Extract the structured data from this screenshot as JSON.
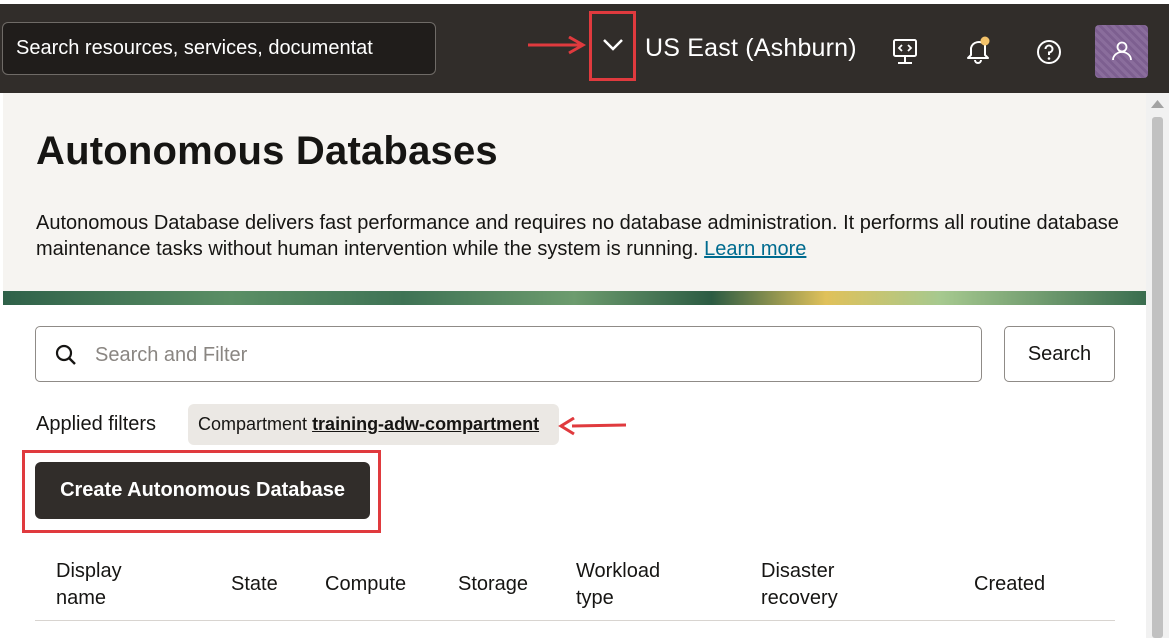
{
  "header": {
    "search_text": "Search resources, services, documentat",
    "region": "US East (Ashburn)",
    "icons": [
      "region-dropdown-chevron-icon",
      "cloud-shell-icon",
      "notifications-bell-icon",
      "help-icon",
      "profile-avatar-icon"
    ]
  },
  "hero": {
    "title": "Autonomous Databases",
    "description": "Autonomous Database delivers fast performance and requires no database administration. It performs all routine database maintenance tasks without human intervention while the system is running.",
    "learn_more": "Learn more"
  },
  "filter": {
    "placeholder": "Search and Filter",
    "search_button": "Search",
    "applied_label": "Applied filters",
    "chip_key": "Compartment",
    "chip_value": "training-adw-compartment"
  },
  "actions": {
    "create_button": "Create Autonomous Database"
  },
  "table": {
    "columns": [
      {
        "line1": "Display",
        "line2": "name"
      },
      {
        "line1": "State",
        "line2": ""
      },
      {
        "line1": "Compute",
        "line2": ""
      },
      {
        "line1": "Storage",
        "line2": ""
      },
      {
        "line1": "Workload",
        "line2": "type"
      },
      {
        "line1": "Disaster",
        "line2": "recovery"
      },
      {
        "line1": "Created",
        "line2": ""
      }
    ]
  },
  "colors": {
    "header_bg": "#312d2a",
    "highlight_red": "#e03a3e",
    "link": "#006b8f",
    "primary_button": "#312d2a"
  }
}
